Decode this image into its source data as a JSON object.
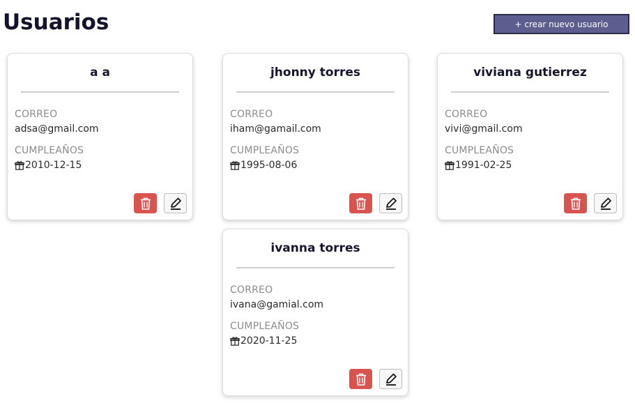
{
  "page": {
    "title": "Usuarios",
    "new_user_button": "+ crear nuevo usuario"
  },
  "labels": {
    "email": "CORREO",
    "birthday": "CUMPLEAÑOS"
  },
  "users": [
    {
      "name": "a a",
      "email": "adsa@gmail.com",
      "birthday": "2010-12-15"
    },
    {
      "name": "jhonny torres",
      "email": "iham@gamail.com",
      "birthday": "1995-08-06"
    },
    {
      "name": "viviana gutierrez",
      "email": "vivi@gmail.com",
      "birthday": "1991-02-25"
    },
    {
      "name": "ivanna torres",
      "email": "ivana@gamial.com",
      "birthday": "2020-11-25"
    }
  ],
  "icons": {
    "birthday": "gift-icon",
    "delete": "trash-icon",
    "edit": "pencil-icon"
  },
  "colors": {
    "primary_button": "#5c5e8f",
    "delete_button": "#d9534f",
    "title": "#13132b"
  }
}
